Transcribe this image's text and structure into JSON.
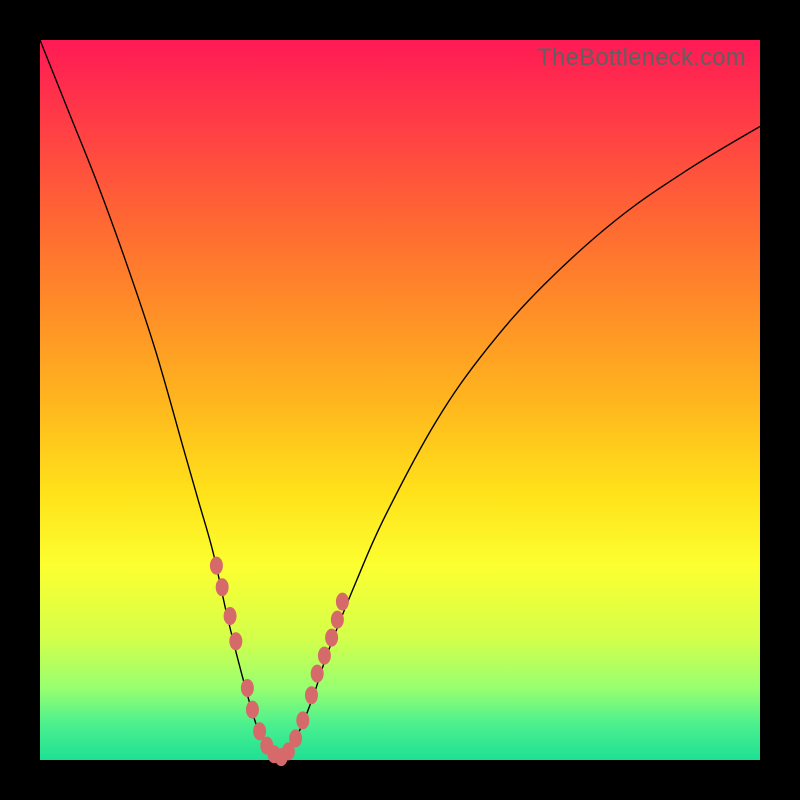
{
  "watermark": "TheBottleneck.com",
  "colors": {
    "frame": "#000000",
    "gradient_top": "#ff1a55",
    "gradient_bottom": "#1ee094",
    "curve": "#000000",
    "dots": "#d66a6a"
  },
  "chart_data": {
    "type": "line",
    "title": "",
    "xlabel": "",
    "ylabel": "",
    "xlim": [
      0,
      100
    ],
    "ylim": [
      0,
      100
    ],
    "grid": false,
    "legend": false,
    "series": [
      {
        "name": "bottleneck-curve",
        "x": [
          0,
          4,
          8,
          12,
          16,
          20,
          22,
          24,
          26,
          28,
          30,
          31,
          32,
          33,
          34,
          36,
          38,
          40,
          44,
          48,
          55,
          62,
          70,
          80,
          90,
          100
        ],
        "y": [
          100,
          90,
          80,
          69,
          57,
          43,
          36,
          29,
          20,
          12,
          5,
          3,
          1,
          0,
          1,
          4,
          9,
          15,
          25,
          34,
          47,
          57,
          66,
          75,
          82,
          88
        ]
      }
    ],
    "marked_points": {
      "name": "highlighted-dots",
      "x": [
        24.5,
        25.3,
        26.4,
        27.2,
        28.8,
        29.5,
        30.5,
        31.5,
        32.5,
        33.5,
        34.5,
        35.5,
        36.5,
        37.7,
        38.5,
        39.5,
        40.5,
        41.3,
        42.0
      ],
      "y": [
        27.0,
        24.0,
        20.0,
        16.5,
        10.0,
        7.0,
        4.0,
        2.0,
        0.8,
        0.4,
        1.2,
        3.0,
        5.5,
        9.0,
        12.0,
        14.5,
        17.0,
        19.5,
        22.0
      ]
    }
  }
}
